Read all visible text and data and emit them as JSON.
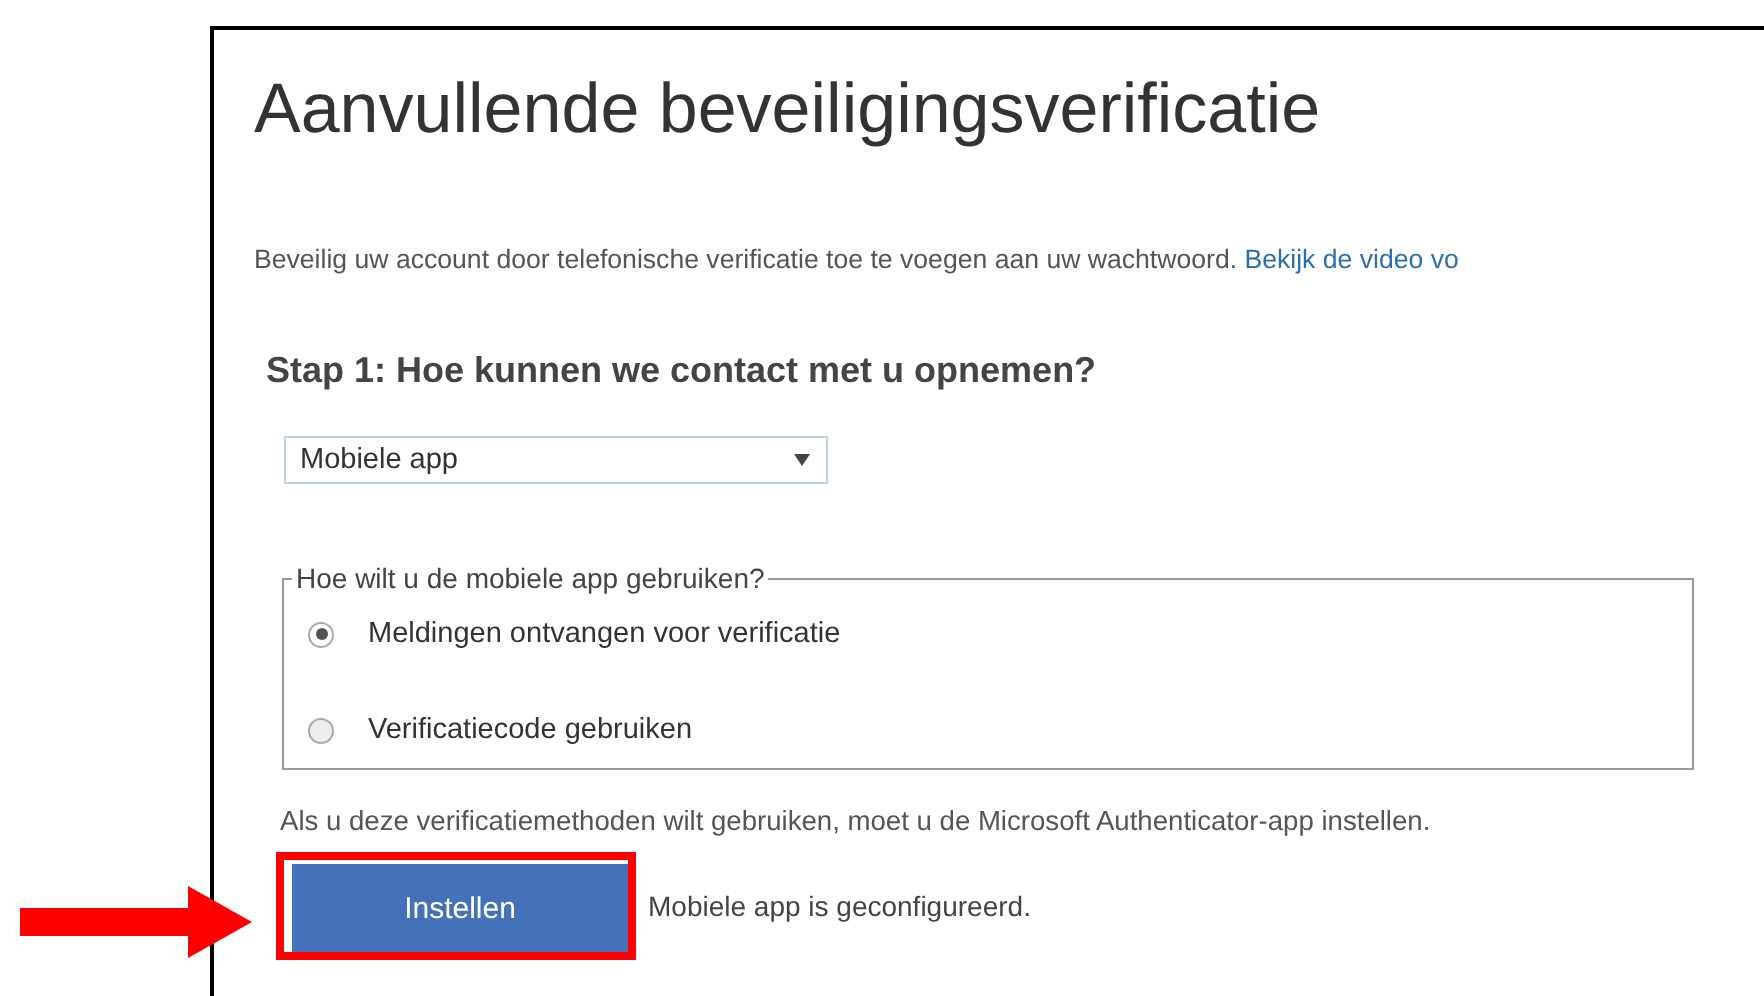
{
  "title": "Aanvullende beveiligingsverificatie",
  "intro": {
    "text": "Beveilig uw account door telefonische verificatie toe te voegen aan uw wachtwoord.",
    "link": "Bekijk de video vo"
  },
  "step_heading": "Stap 1: Hoe kunnen we contact met u opnemen?",
  "method_select": {
    "value": "Mobiele app"
  },
  "usage": {
    "legend": "Hoe wilt u de mobiele app gebruiken?",
    "options": [
      {
        "label": "Meldingen ontvangen voor verificatie",
        "selected": true
      },
      {
        "label": "Verificatiecode gebruiken",
        "selected": false
      }
    ]
  },
  "note": "Als u deze verificatiemethoden wilt gebruiken, moet u de Microsoft Authenticator-app instellen.",
  "setup_button": "Instellen",
  "status": "Mobiele app is geconfigureerd."
}
